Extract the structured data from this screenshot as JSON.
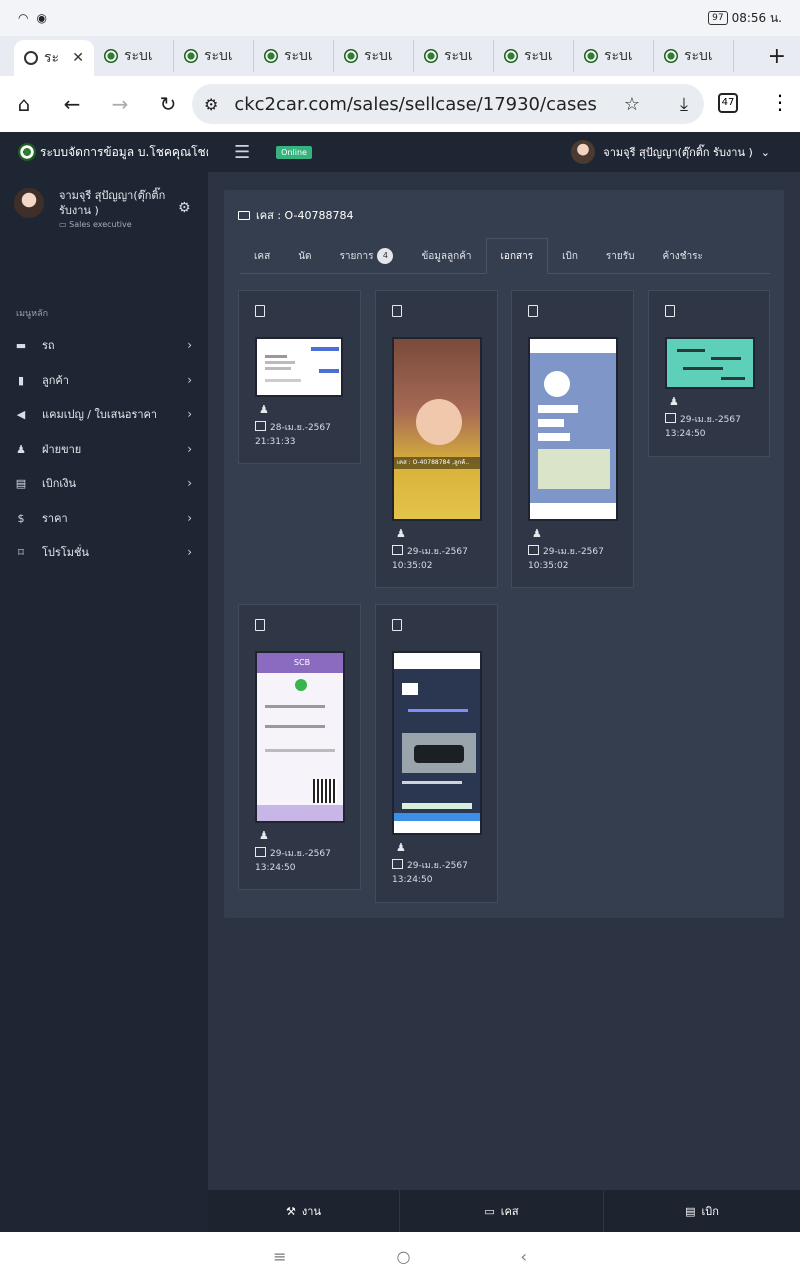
{
  "status": {
    "battery": "97",
    "time": "08:56 น."
  },
  "browser": {
    "active_tab_label": "ระ",
    "tab_label": "ระบเ",
    "tab_count": "47",
    "url": "ckc2car.com/sales/sellcase/17930/cases"
  },
  "app": {
    "brand": "ระบบจัดการข้อมูล บ.โชคคุณโชค",
    "online": "Online",
    "user_display": "จามจุรี สุปัญญา(ตุ๊กติ๊ก รับงาน )",
    "profile_name": "จามจุรี สุปัญญา(ตุ๊กติ๊ก รับงาน )",
    "profile_role": "Sales executive",
    "menu_heading": "เมนูหลัก",
    "menu": [
      {
        "label": "รถ",
        "icon": "car-icon"
      },
      {
        "label": "ลูกค้า",
        "icon": "contacts-icon"
      },
      {
        "label": "แคมเปญ / ใบเสนอราคา",
        "icon": "megaphone-icon"
      },
      {
        "label": "ฝ่ายขาย",
        "icon": "salesperson-icon"
      },
      {
        "label": "เบิกเงิน",
        "icon": "money-icon"
      },
      {
        "label": "ราคา",
        "icon": "dollar-icon"
      },
      {
        "label": "โปรโมชั่น",
        "icon": "bookmark-icon"
      }
    ]
  },
  "case": {
    "title": "เคส : O-40788784",
    "tabs": [
      {
        "label": "เคส"
      },
      {
        "label": "นัด"
      },
      {
        "label": "รายการ",
        "badge": "4"
      },
      {
        "label": "ข้อมูลลูกค้า"
      },
      {
        "label": "เอกสาร",
        "active": true
      },
      {
        "label": "เบิก"
      },
      {
        "label": "รายรับ"
      },
      {
        "label": "ค้างชำระ"
      }
    ],
    "documents": [
      {
        "date": "28-เม.ย.-2567",
        "time": "21:31:33"
      },
      {
        "date": "29-เม.ย.-2567",
        "time": "10:35:02"
      },
      {
        "date": "29-เม.ย.-2567",
        "time": "10:35:02"
      },
      {
        "date": "29-เม.ย.-2567",
        "time": "13:24:50"
      },
      {
        "date": "29-เม.ย.-2567",
        "time": "13:24:50"
      },
      {
        "date": "29-เม.ย.-2567",
        "time": "13:24:50"
      }
    ],
    "thumb_texts": {
      "doc2_caption": "เคส : O-40788784 ,ลูกค้..",
      "doc5_bank": "SCB"
    }
  },
  "bottom": {
    "work": "งาน",
    "case": "เคส",
    "withdraw": "เบิก"
  }
}
